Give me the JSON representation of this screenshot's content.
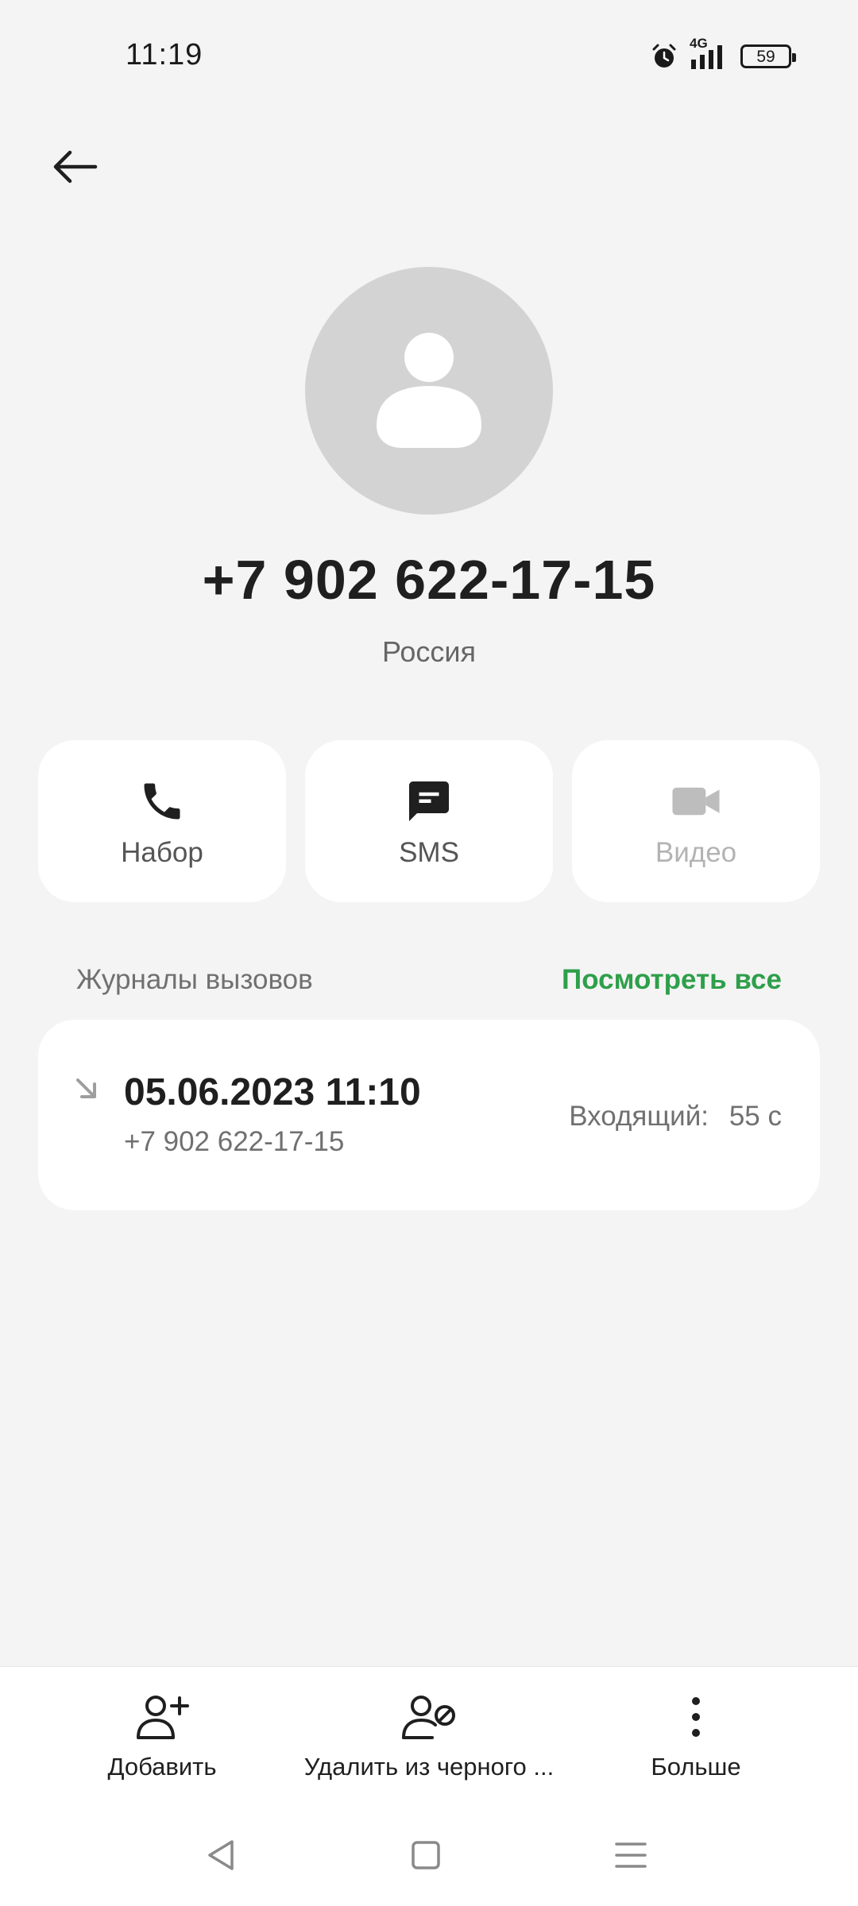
{
  "status_bar": {
    "time": "11:19",
    "network": "4G",
    "battery": "59",
    "icons": [
      "alarm-icon",
      "signal-icon",
      "battery-icon"
    ]
  },
  "contact": {
    "number": "+7 902 622-17-15",
    "country": "Россия"
  },
  "actions": {
    "dial_label": "Набор",
    "sms_label": "SMS",
    "video_label": "Видео"
  },
  "call_log": {
    "title": "Журналы вызовов",
    "view_all": "Посмотреть все",
    "entries": [
      {
        "datetime": "05.06.2023 11:10",
        "number": "+7 902 622-17-15",
        "type": "Входящий:",
        "duration": "55 с"
      }
    ]
  },
  "bottom_actions": {
    "add_label": "Добавить",
    "remove_blacklist_label": "Удалить из черного ...",
    "more_label": "Больше"
  },
  "colors": {
    "accent": "#2e9f4a",
    "background": "#f4f4f4",
    "card": "#ffffff",
    "avatar": "#d3d3d3"
  }
}
